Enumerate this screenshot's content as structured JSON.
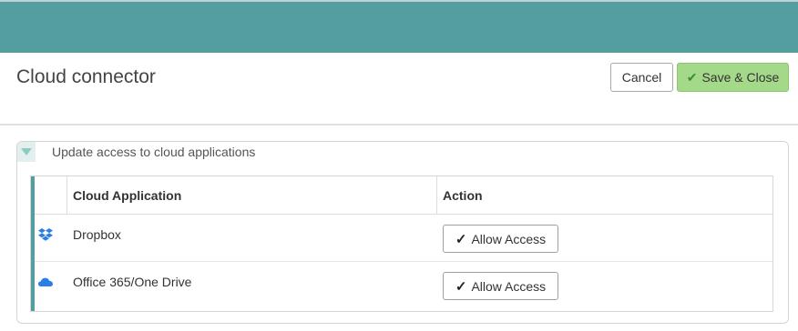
{
  "header": {
    "title": "Cloud connector",
    "cancel_label": "Cancel",
    "save_label": "Save & Close"
  },
  "panel": {
    "title": "Update access to cloud applications"
  },
  "table": {
    "columns": [
      "",
      "Cloud Application",
      "Action"
    ],
    "rows": [
      {
        "icon": "dropbox-icon",
        "name": "Dropbox",
        "action_label": "Allow Access"
      },
      {
        "icon": "onedrive-icon",
        "name": "Office 365/One Drive",
        "action_label": "Allow Access"
      }
    ]
  },
  "colors": {
    "topbar": "#559ea0",
    "save_button": "#a4d989",
    "icon_blue": "#2b7de9"
  }
}
